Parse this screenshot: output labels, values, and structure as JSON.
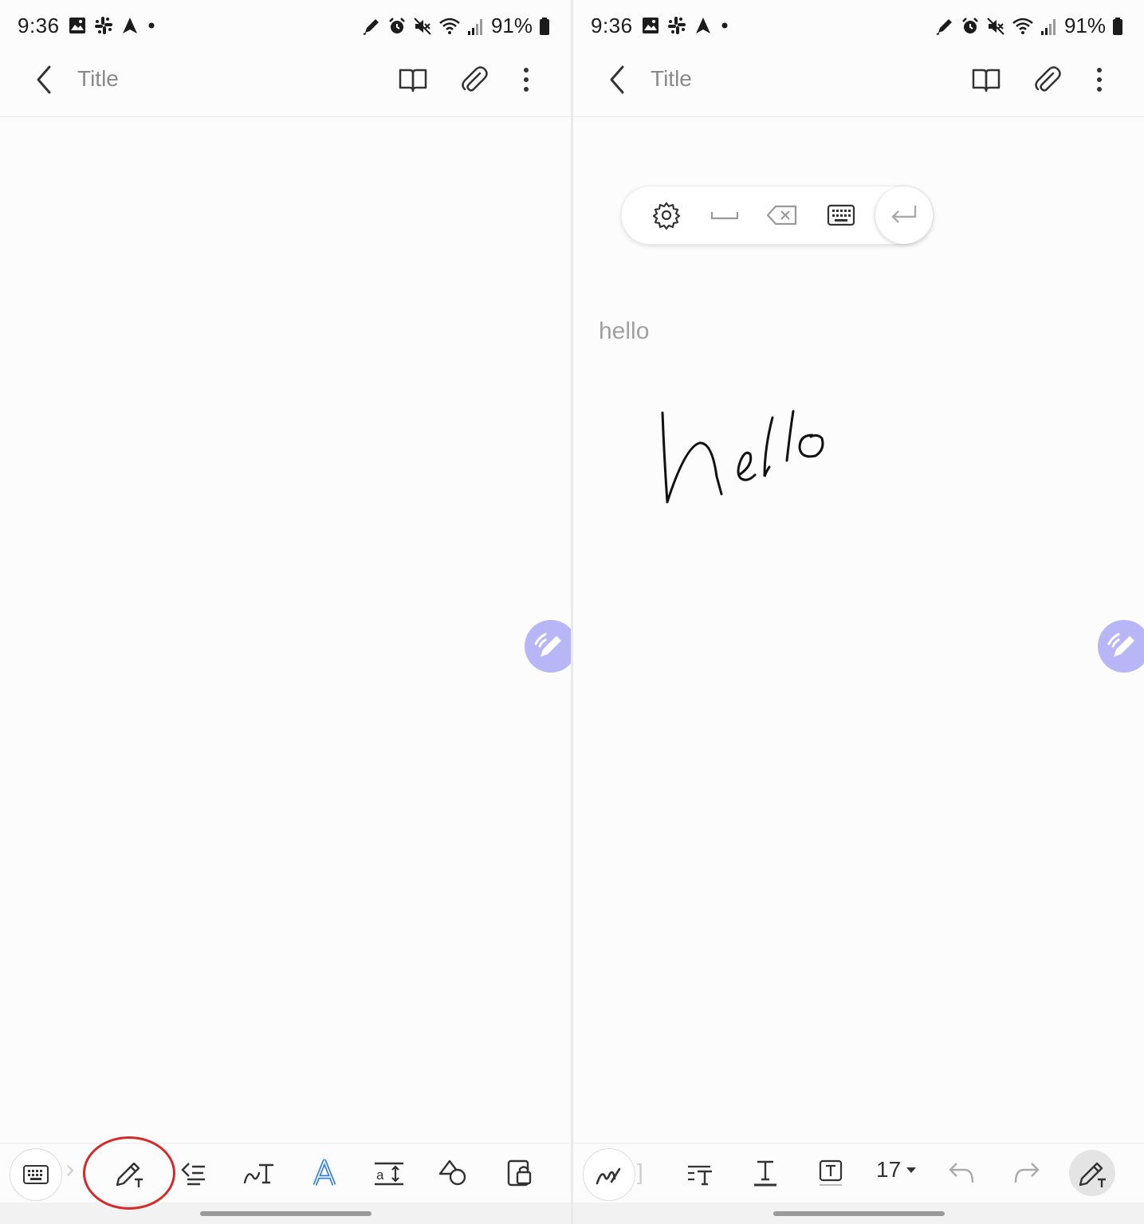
{
  "status_bar": {
    "time": "9:36",
    "battery": "91%"
  },
  "app_bar": {
    "title": "Title"
  },
  "recognized_text": "hello",
  "handwriting": "hello",
  "right_toolbar": {
    "font_size": "17"
  },
  "colors": {
    "fab": "#b8b6f6",
    "annotation": "#d42a2a",
    "highlight_a": "#2f7fe6"
  },
  "icons": {
    "status_left": [
      "gallery-icon",
      "slack-icon",
      "navigation-icon",
      "dot-icon"
    ],
    "status_right": [
      "pen-icon",
      "alarm-icon",
      "mute-icon",
      "wifi-icon",
      "signal-icon",
      "battery-icon"
    ],
    "app_bar": [
      "back-icon",
      "book-icon",
      "attach-icon",
      "more-icon"
    ],
    "left_toolbar": [
      "keyboard-icon",
      "pen-to-text-icon",
      "align-icon",
      "handwriting-icon",
      "text-style-icon",
      "text-size-icon",
      "shapes-icon",
      "lock-icon"
    ],
    "handwriting_pill": [
      "settings-icon",
      "space-icon",
      "backspace-icon",
      "keyboard-icon",
      "enter-icon"
    ],
    "right_toolbar": [
      "pen-icon",
      "text-align-icon",
      "text-underline-icon",
      "text-box-icon",
      "undo-icon",
      "redo-icon",
      "pen-to-text-icon"
    ]
  }
}
